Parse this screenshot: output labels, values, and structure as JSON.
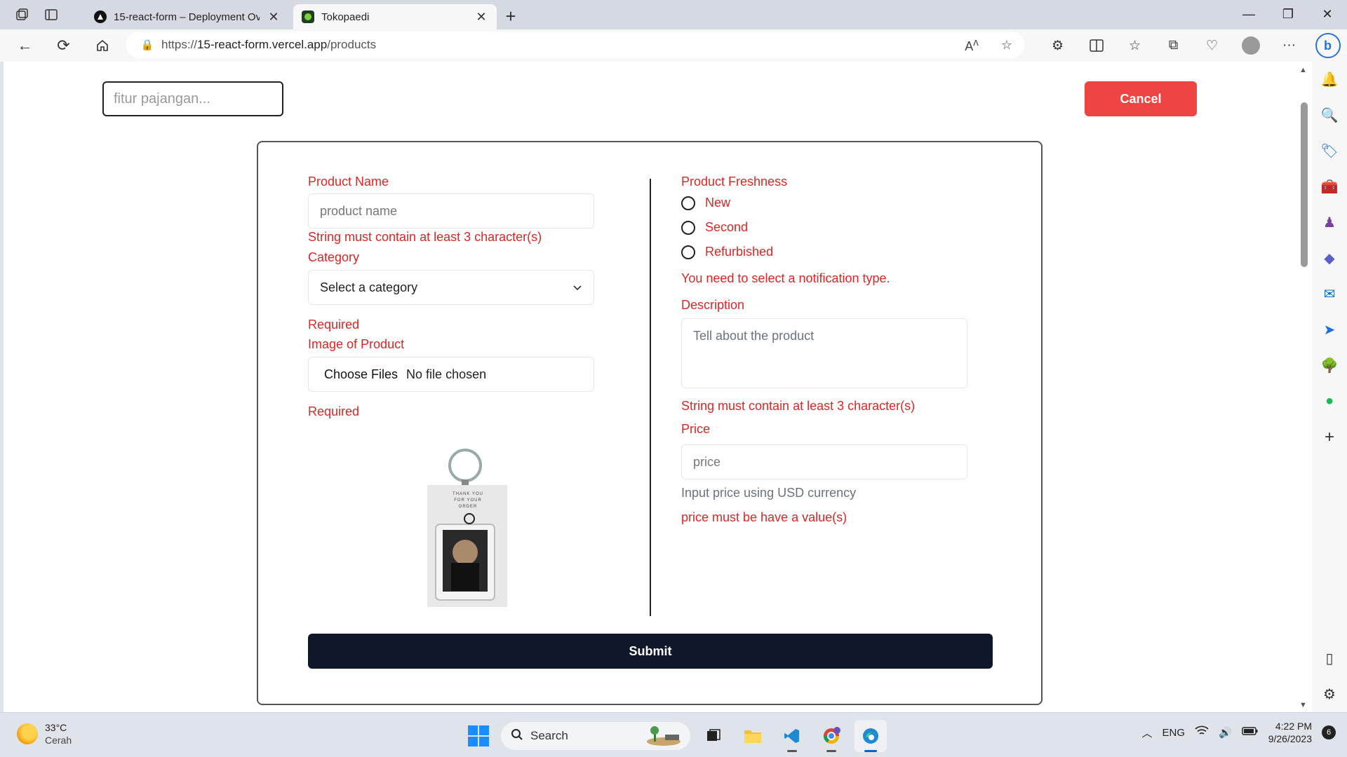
{
  "browser": {
    "tabs": [
      {
        "title": "15-react-form – Deployment Ove",
        "active": false
      },
      {
        "title": "Tokopaedi",
        "active": true
      }
    ],
    "url_prefix": "https://",
    "url_host": "15-react-form.vercel.app",
    "url_path": "/products",
    "read_aloud_label": "A",
    "bing_label": "b"
  },
  "page": {
    "search_placeholder": "fitur pajangan...",
    "cancel_label": "Cancel",
    "form": {
      "product_name_label": "Product Name",
      "product_name_placeholder": "product name",
      "product_name_error": "String must contain at least 3 character(s)",
      "category_label": "Category",
      "category_value": "Select a category",
      "category_error": "Required",
      "image_label": "Image of Product",
      "choose_files_label": "Choose Files",
      "no_file_label": "No file chosen",
      "image_error": "Required",
      "freshness_label": "Product Freshness",
      "freshness_options": [
        "New",
        "Second",
        "Refurbished"
      ],
      "freshness_error": "You need to select a notification type.",
      "description_label": "Description",
      "description_placeholder": "Tell about the product",
      "description_error": "String must contain at least 3 character(s)",
      "price_label": "Price",
      "price_placeholder": "price",
      "price_hint": "Input price using USD currency",
      "price_error": "price must be have a value(s)",
      "submit_label": "Submit"
    },
    "product_image": {
      "caption_line1": "THANK YOU",
      "caption_line2": "FOR YOUR ORDER"
    }
  },
  "taskbar": {
    "weather_temp": "33°C",
    "weather_desc": "Cerah",
    "search_label": "Search",
    "language": "ENG",
    "time": "4:22 PM",
    "date": "9/26/2023",
    "notification_count": "6"
  },
  "colors": {
    "error_red": "#dc2626",
    "cancel_red": "#ef4444",
    "submit_navy": "#0f172a"
  }
}
